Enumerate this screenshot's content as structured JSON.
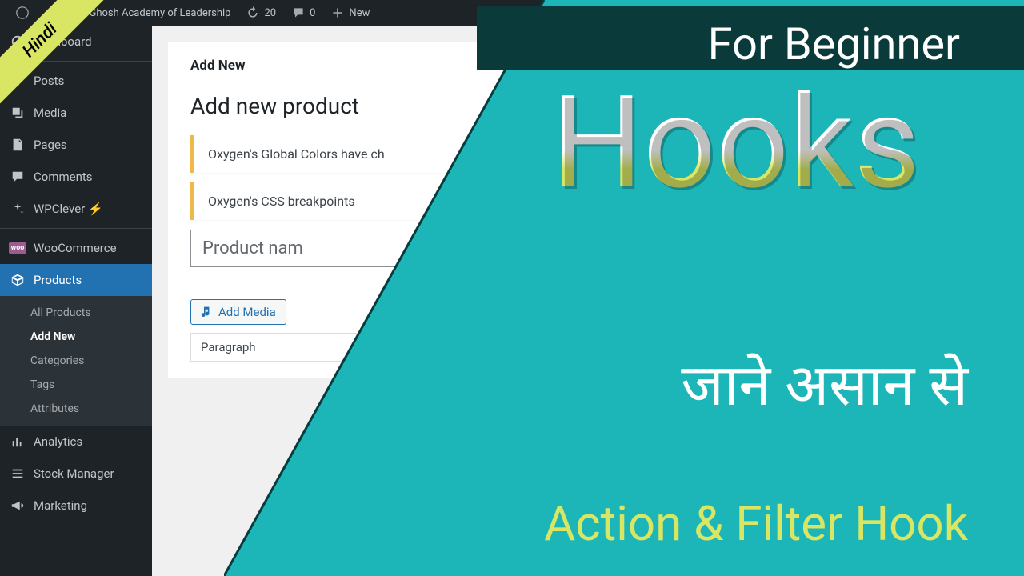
{
  "ribbon": {
    "label": "Hindi"
  },
  "adminbar": {
    "site_name": "artha Ghosh Academy of Leadership",
    "updates": "20",
    "comments": "0",
    "new": "New"
  },
  "sidebar": {
    "dashboard": "Dashboard",
    "posts": "Posts",
    "media": "Media",
    "pages": "Pages",
    "comments": "Comments",
    "wpclever": "WPClever ⚡",
    "woocommerce": "WooCommerce",
    "products": "Products",
    "submenu": {
      "all": "All Products",
      "add": "Add New",
      "categories": "Categories",
      "tags": "Tags",
      "attributes": "Attributes"
    },
    "analytics": "Analytics",
    "stock": "Stock Manager",
    "marketing": "Marketing"
  },
  "content": {
    "tab": "Add New",
    "title": "Add new product",
    "notice1": "Oxygen's Global Colors have ch",
    "notice2": "Oxygen's CSS breakpoints",
    "product_placeholder": "Product nam",
    "add_media": "Add Media",
    "paragraph": "Paragraph"
  },
  "overlay": {
    "beginner": "For Beginner",
    "hooks": "Hooks",
    "hindi_line": "जाने असान से",
    "action": "Action & Filter Hook"
  }
}
